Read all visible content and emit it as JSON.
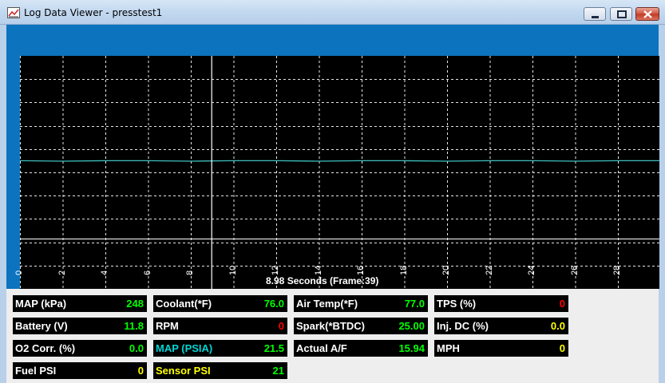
{
  "window": {
    "title": "Log Data Viewer - presstest1",
    "icon": "chart-app-icon"
  },
  "chart": {
    "status": "8.98 Seconds (Frame:39)",
    "x_tick_labels": [
      "0",
      "2",
      "4",
      "6",
      "8",
      "10",
      "12",
      "14",
      "16",
      "18",
      "20",
      "22",
      "24",
      "26",
      "28"
    ],
    "colors": {
      "background": "#000000",
      "grid": "#ffffff",
      "trace": "#3fbfbf",
      "cursor": "#ffffff",
      "panel": "#0c73be"
    }
  },
  "chart_data": {
    "type": "line",
    "title": "",
    "xlabel": "8.98 Seconds (Frame:39)",
    "ylabel": "",
    "x_ticks": [
      0,
      2,
      4,
      6,
      8,
      10,
      12,
      14,
      16,
      18,
      20,
      22,
      24,
      26,
      28
    ],
    "xlim": [
      0,
      30
    ],
    "grid": true,
    "cursor_x": 8.98,
    "series": [
      {
        "x": [
          0,
          2,
          4,
          6,
          8,
          10,
          12,
          14,
          16,
          18,
          20,
          22,
          24,
          26,
          28,
          30
        ],
        "values": [
          0.55,
          0.55,
          0.55,
          0.55,
          0.55,
          0.55,
          0.55,
          0.55,
          0.55,
          0.55,
          0.55,
          0.55,
          0.55,
          0.55,
          0.55,
          0.55
        ]
      }
    ],
    "y_grid_lines": 10
  },
  "gauges": [
    {
      "label": "MAP (kPa)",
      "value": "248",
      "label_color": "white",
      "value_color": "green"
    },
    {
      "label": "Coolant(*F)",
      "value": "76.0",
      "label_color": "white",
      "value_color": "green"
    },
    {
      "label": "Air Temp(*F)",
      "value": "77.0",
      "label_color": "white",
      "value_color": "green"
    },
    {
      "label": "TPS (%)",
      "value": "0",
      "label_color": "white",
      "value_color": "red"
    },
    {
      "label": "Battery (V)",
      "value": "11.8",
      "label_color": "white",
      "value_color": "green"
    },
    {
      "label": "RPM",
      "value": "0",
      "label_color": "white",
      "value_color": "red"
    },
    {
      "label": "Spark(*BTDC)",
      "value": "25.00",
      "label_color": "white",
      "value_color": "green"
    },
    {
      "label": "Inj. DC (%)",
      "value": "0.0",
      "label_color": "white",
      "value_color": "yellow"
    },
    {
      "label": "O2 Corr. (%)",
      "value": "0.0",
      "label_color": "white",
      "value_color": "green"
    },
    {
      "label": "MAP (PSIA)",
      "value": "21.5",
      "label_color": "cyan",
      "value_color": "green"
    },
    {
      "label": "Actual A/F",
      "value": "15.94",
      "label_color": "white",
      "value_color": "green"
    },
    {
      "label": "MPH",
      "value": "0",
      "label_color": "white",
      "value_color": "yellow"
    },
    {
      "label": "Fuel PSI",
      "value": "0",
      "label_color": "white",
      "value_color": "yellow"
    },
    {
      "label": "Sensor PSI",
      "value": "21",
      "label_color": "yellow",
      "value_color": "green"
    }
  ]
}
